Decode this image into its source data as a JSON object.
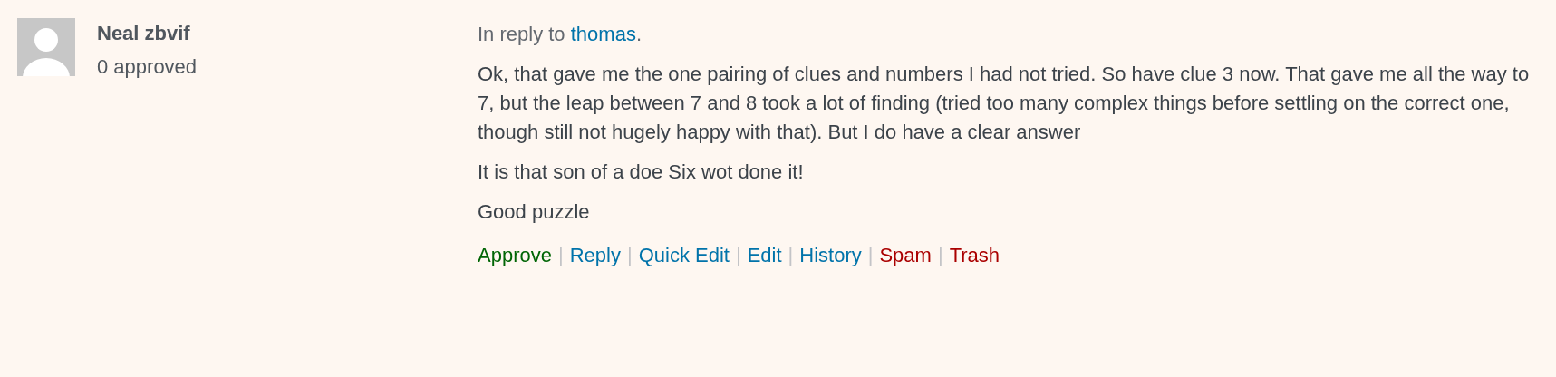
{
  "author": {
    "name": "Neal zbvif",
    "status": "0 approved"
  },
  "reply": {
    "prefix": "In reply to",
    "link": "thomas",
    "suffix": "."
  },
  "paragraphs": [
    "Ok, that gave me the one pairing of clues and numbers I had not tried. So have clue 3 now. That gave me all the way to 7, but the leap between 7 and 8 took a lot of finding (tried too many complex things before settling on the correct one, though still not hugely happy with that). But I do have a clear answer",
    "It is that son of a doe Six wot done it!",
    "Good puzzle"
  ],
  "actions": [
    {
      "label": "Approve",
      "kind": "approve"
    },
    {
      "label": "Reply",
      "kind": "link",
      "separator": "|"
    },
    {
      "label": "Quick Edit",
      "kind": "link",
      "separator": "|"
    },
    {
      "label": "Edit",
      "kind": "link",
      "separator": "|"
    },
    {
      "label": "History",
      "kind": "link",
      "separator": "|"
    },
    {
      "label": "Spam",
      "kind": "danger",
      "separator": "|"
    },
    {
      "label": "Trash",
      "kind": "danger",
      "separator": "|"
    }
  ]
}
